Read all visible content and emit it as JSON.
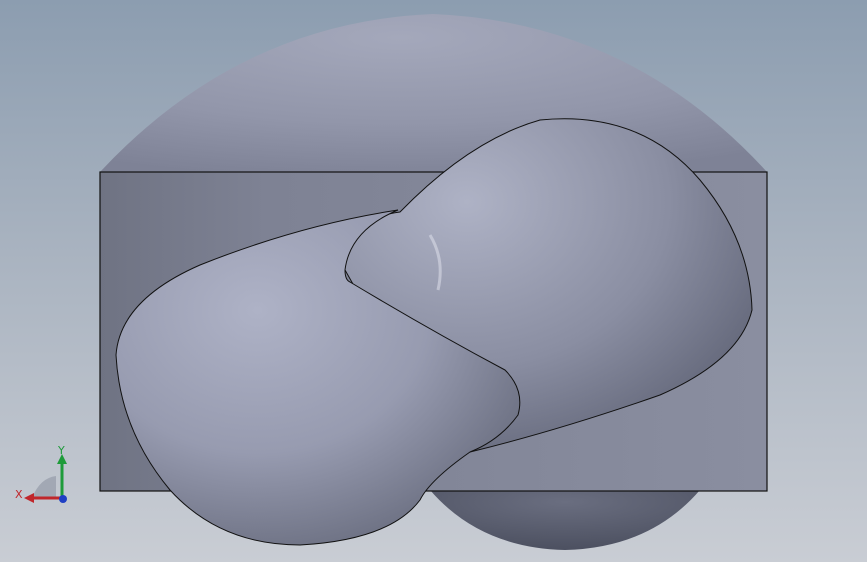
{
  "viewport": {
    "background_top": "#8c9db0",
    "background_bottom": "#c9cdd4",
    "model_color": "#8e93a8"
  },
  "triad": {
    "x_label": "X",
    "y_label": "Y",
    "x_color": "#c0262b",
    "y_color": "#1e9b3a",
    "z_color": "#1f3fc4"
  }
}
